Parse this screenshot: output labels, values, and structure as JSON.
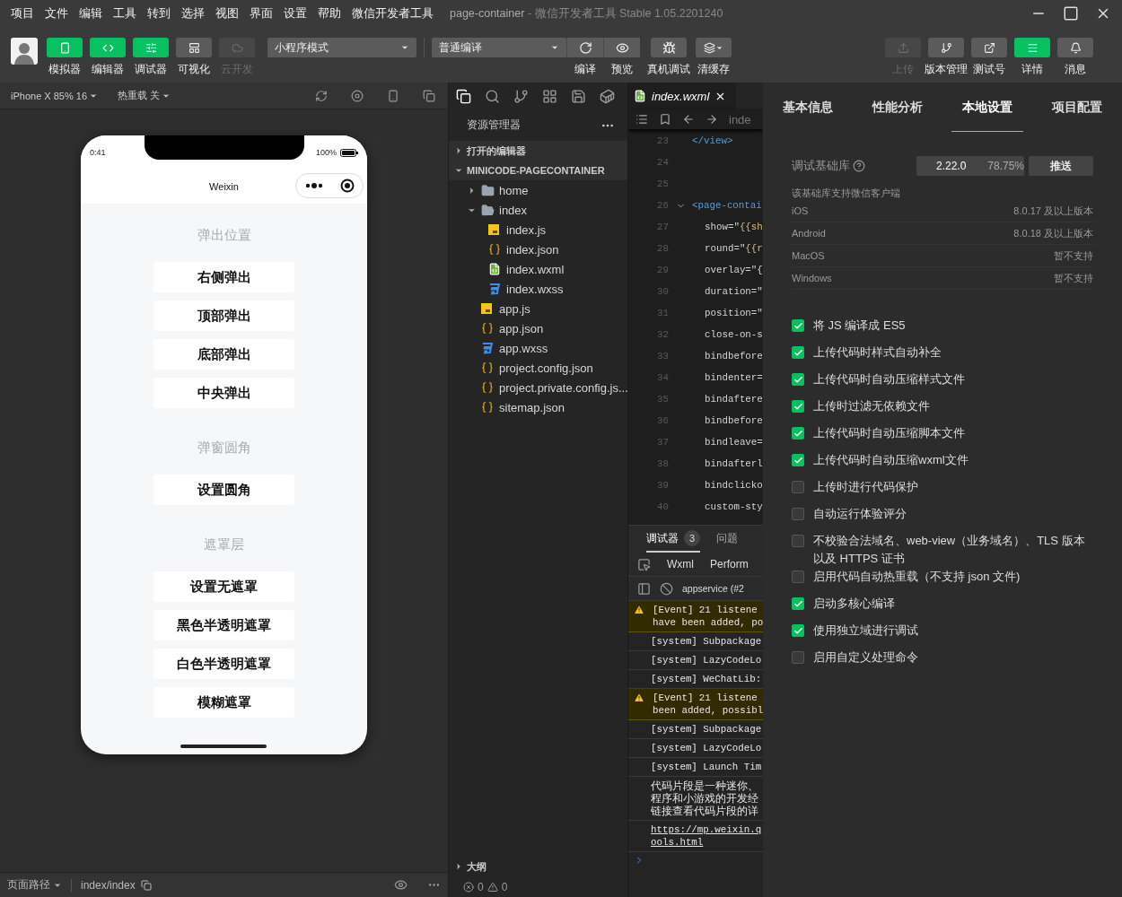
{
  "menu": [
    "项目",
    "文件",
    "编辑",
    "工具",
    "转到",
    "选择",
    "视图",
    "界面",
    "设置",
    "帮助",
    "微信开发者工具"
  ],
  "window": {
    "title": "page-container",
    "subtitle": "- 微信开发者工具 Stable 1.05.2201240"
  },
  "toolbar": {
    "left": [
      {
        "label": "模拟器",
        "active": true,
        "disabled": false
      },
      {
        "label": "编辑器",
        "active": true,
        "disabled": false
      },
      {
        "label": "调试器",
        "active": true,
        "disabled": false
      },
      {
        "label": "可视化",
        "active": false,
        "disabled": false
      },
      {
        "label": "云开发",
        "active": false,
        "disabled": true
      }
    ],
    "mode": "小程序模式",
    "compile": {
      "value": "普通编译",
      "buttons": [
        "编译",
        "预览"
      ]
    },
    "tools": [
      {
        "label": "真机调试",
        "caret": false
      },
      {
        "label": "清缓存",
        "caret": true
      }
    ],
    "right": [
      {
        "label": "上传",
        "active": false,
        "disabled": true
      },
      {
        "label": "版本管理",
        "active": false,
        "disabled": false
      },
      {
        "label": "测试号",
        "active": false,
        "disabled": false
      },
      {
        "label": "详情",
        "active": true,
        "disabled": false
      },
      {
        "label": "消息",
        "active": false,
        "disabled": false
      }
    ]
  },
  "simulator": {
    "device": "iPhone X 85% 16",
    "hot_reload": "热重载 关",
    "time": "0:41",
    "battery": "100%",
    "nav_title": "Weixin",
    "sections": [
      {
        "title": "弹出位置",
        "buttons": [
          "右侧弹出",
          "顶部弹出",
          "底部弹出",
          "中央弹出"
        ]
      },
      {
        "title": "弹窗圆角",
        "buttons": [
          "设置圆角"
        ]
      },
      {
        "title": "遮罩层",
        "buttons": [
          "设置无遮罩",
          "黑色半透明遮罩",
          "白色半透明遮罩",
          "模糊遮罩"
        ]
      }
    ],
    "footer": {
      "path_label": "页面路径",
      "path": "index/index"
    }
  },
  "explorer": {
    "title": "资源管理器",
    "sections": [
      {
        "label": "打开的编辑器",
        "expanded": false
      },
      {
        "label": "MINICODE-PAGECONTAINER",
        "expanded": true,
        "children": [
          {
            "kind": "folder",
            "label": "home",
            "expanded": false
          },
          {
            "kind": "folder",
            "label": "index",
            "expanded": true,
            "children": [
              {
                "kind": "js",
                "label": "index.js"
              },
              {
                "kind": "json",
                "label": "index.json"
              },
              {
                "kind": "wxml",
                "label": "index.wxml"
              },
              {
                "kind": "wxss",
                "label": "index.wxss"
              }
            ]
          },
          {
            "kind": "js",
            "label": "app.js"
          },
          {
            "kind": "json",
            "label": "app.json"
          },
          {
            "kind": "wxss",
            "label": "app.wxss"
          },
          {
            "kind": "json",
            "label": "project.config.json"
          },
          {
            "kind": "json",
            "label": "project.private.config.js..."
          },
          {
            "kind": "json",
            "label": "sitemap.json"
          }
        ]
      }
    ],
    "outline": {
      "label": "大纲",
      "expanded": false
    },
    "errors": "0",
    "warnings": "0"
  },
  "editor": {
    "tab": "index.wxml",
    "breadcrumb": "inde",
    "lines": [
      {
        "number": "23",
        "kind": "tag",
        "text": "</view>",
        "foldable": false
      },
      {
        "number": "24",
        "kind": "blank",
        "foldable": false
      },
      {
        "number": "25",
        "kind": "blank",
        "foldable": false
      },
      {
        "number": "26",
        "kind": "tag",
        "text": "<page-contai",
        "foldable": true
      },
      {
        "number": "27",
        "kind": "attr",
        "text": "show=\"{{sh",
        "foldable": false
      },
      {
        "number": "28",
        "kind": "attr",
        "text": "round=\"{{r",
        "foldable": false
      },
      {
        "number": "29",
        "kind": "attr",
        "text": "overlay=\"{",
        "foldable": false
      },
      {
        "number": "30",
        "kind": "attr",
        "text": "duration=\"",
        "foldable": false
      },
      {
        "number": "31",
        "kind": "attr",
        "text": "position=\"",
        "foldable": false
      },
      {
        "number": "32",
        "kind": "attr",
        "text": "close-on-s",
        "foldable": false
      },
      {
        "number": "33",
        "kind": "attr",
        "text": "bindbefore",
        "foldable": false
      },
      {
        "number": "34",
        "kind": "attr",
        "text": "bindenter=",
        "foldable": false
      },
      {
        "number": "35",
        "kind": "attr",
        "text": "bindaftere",
        "foldable": false
      },
      {
        "number": "36",
        "kind": "attr",
        "text": "bindbefore",
        "foldable": false
      },
      {
        "number": "37",
        "kind": "attr",
        "text": "bindleave=",
        "foldable": false
      },
      {
        "number": "38",
        "kind": "attr",
        "text": "bindafterl",
        "foldable": false
      },
      {
        "number": "39",
        "kind": "attr",
        "text": "bindclicko",
        "foldable": false
      },
      {
        "number": "40",
        "kind": "attr",
        "text": "custom-sty",
        "foldable": false
      }
    ]
  },
  "debugger": {
    "tabs": [
      {
        "label": "调试器",
        "badge": "3",
        "selected": true
      },
      {
        "label": "问题",
        "selected": false
      }
    ],
    "panels": [
      "Wxml",
      "Perform"
    ],
    "context": "appservice (#2",
    "logs": [
      {
        "kind": "warning",
        "lines": [
          "[Event] 21 listene",
          "have been added, po"
        ]
      },
      {
        "kind": "system",
        "lines": [
          "[system] Subpackage"
        ]
      },
      {
        "kind": "system",
        "lines": [
          "[system] LazyCodeLo"
        ]
      },
      {
        "kind": "system",
        "lines": [
          "[system] WeChatLib:"
        ]
      },
      {
        "kind": "warning",
        "lines": [
          "[Event] 21 listene",
          "been added, possibl"
        ]
      },
      {
        "kind": "system",
        "lines": [
          "[system] Subpackage"
        ]
      },
      {
        "kind": "system",
        "lines": [
          "[system] LazyCodeLo"
        ]
      },
      {
        "kind": "system",
        "lines": [
          "[system] Launch Tim"
        ]
      },
      {
        "kind": "info",
        "lines": [
          "代码片段是一种迷你、",
          "程序和小游戏的开发经",
          "链接查看代码片段的详"
        ]
      },
      {
        "kind": "link",
        "lines": [
          "https://mp.weixin.q",
          "ools.html"
        ]
      }
    ]
  },
  "details": {
    "tabs": [
      {
        "label": "基本信息",
        "selected": false
      },
      {
        "label": "性能分析",
        "selected": false
      },
      {
        "label": "本地设置",
        "selected": true
      },
      {
        "label": "项目配置",
        "selected": false
      }
    ],
    "base_lib": {
      "label": "调试基础库",
      "version": "2.22.0",
      "share": "78.75%",
      "push": "推送"
    },
    "support": {
      "title": "该基础库支持微信客户端",
      "rows": [
        {
          "platform": "iOS",
          "value": "8.0.17 及以上版本"
        },
        {
          "platform": "Android",
          "value": "8.0.18 及以上版本"
        },
        {
          "platform": "MacOS",
          "value": "暂不支持"
        },
        {
          "platform": "Windows",
          "value": "暂不支持"
        }
      ]
    },
    "options": [
      {
        "label": "将 JS 编译成 ES5",
        "checked": true
      },
      {
        "label": "上传代码时样式自动补全",
        "checked": true
      },
      {
        "label": "上传代码时自动压缩样式文件",
        "checked": true
      },
      {
        "label": "上传时过滤无依赖文件",
        "checked": true
      },
      {
        "label": "上传代码时自动压缩脚本文件",
        "checked": true
      },
      {
        "label": "上传代码时自动压缩wxml文件",
        "checked": true
      },
      {
        "label": "上传时进行代码保护",
        "checked": false
      },
      {
        "label": "自动运行体验评分",
        "checked": false
      },
      {
        "label": "不校验合法域名、web-view（业务域名）、TLS 版本以及 HTTPS 证书",
        "checked": false
      },
      {
        "label": "启用代码自动热重载（不支持 json 文件)",
        "checked": false
      },
      {
        "label": "启动多核心编译",
        "checked": true
      },
      {
        "label": "使用独立域进行调试",
        "checked": true
      },
      {
        "label": "启用自定义处理命令",
        "checked": false
      }
    ]
  }
}
